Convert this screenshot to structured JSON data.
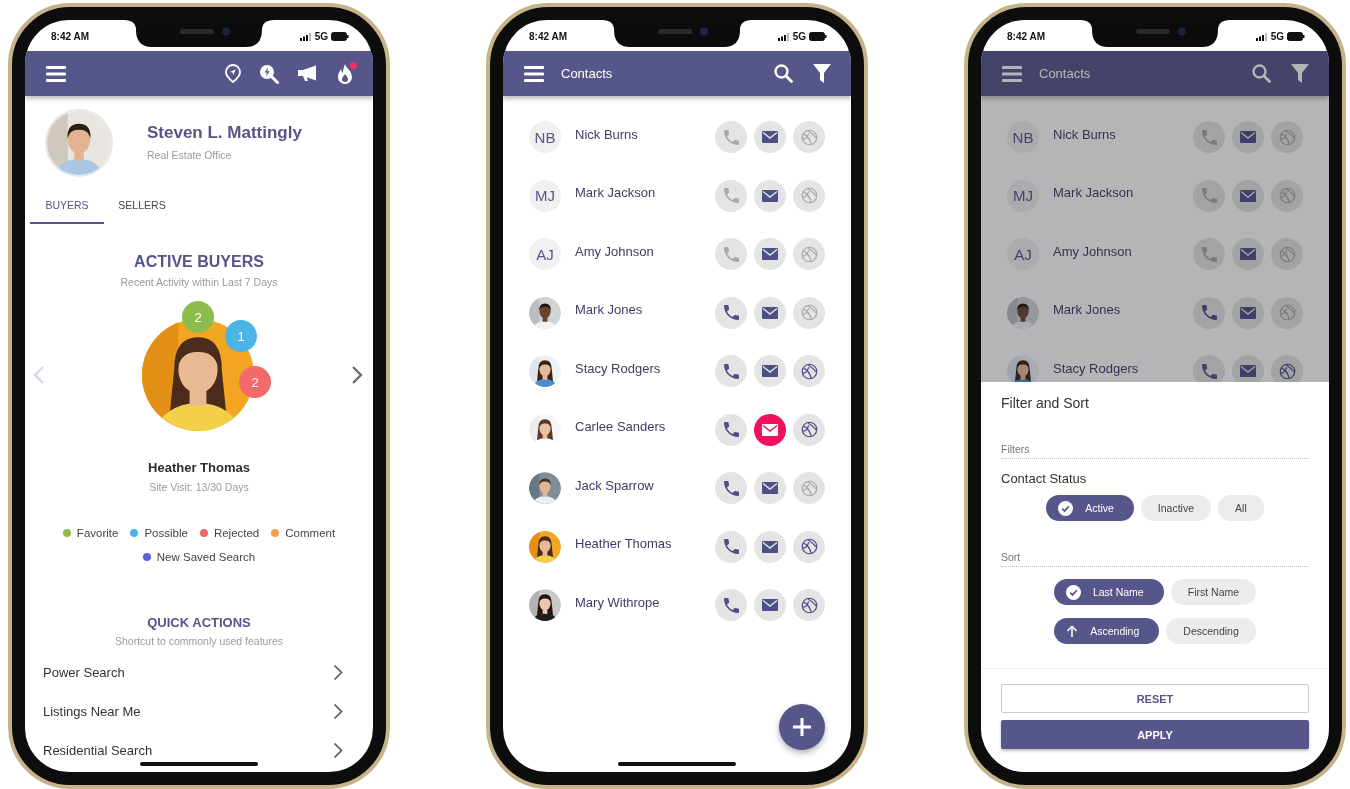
{
  "dashboard_screen": {
    "status_bar": {
      "time": "8:42 AM",
      "network": "5G"
    },
    "app_bar": {
      "fire_alert": true
    },
    "profile": {
      "name": "Steven L. Mattingly",
      "subtitle": "Real Estate Office"
    },
    "tabs": [
      {
        "label": "BUYERS",
        "selected": true
      },
      {
        "label": "SELLERS",
        "selected": false
      }
    ],
    "active_buyers": {
      "title": "ACTIVE BUYERS",
      "subtitle": "Recent Activity within Last 7 Days",
      "prev_disabled": true,
      "buyer_name": "Heather Thomas",
      "buyer_detail": "Site Visit: 13/30 Days",
      "badges": [
        {
          "count": "2",
          "color": "#8cbd4c"
        },
        {
          "count": "1",
          "color": "#4cb4e4"
        },
        {
          "count": "2",
          "color": "#f26a6a"
        }
      ]
    },
    "legend": [
      {
        "label": "Favorite",
        "color": "#8cbd4c"
      },
      {
        "label": "Possible",
        "color": "#4cb4e4"
      },
      {
        "label": "Rejected",
        "color": "#f26565"
      },
      {
        "label": "Comment",
        "color": "#f5a04a"
      },
      {
        "label": "New Saved Search",
        "color": "#5a64d6"
      }
    ],
    "quick_actions": {
      "title": "QUICK ACTIONS",
      "subtitle": "Shortcut to commonly used features",
      "items": [
        {
          "label": "Power Search"
        },
        {
          "label": "Listings Near Me"
        },
        {
          "label": "Residential Search"
        }
      ]
    }
  },
  "contacts_screen": {
    "status_bar": {
      "time": "8:42 AM",
      "network": "5G"
    },
    "title": "Contacts",
    "contacts": [
      {
        "kind": "initials",
        "initials": "NB",
        "name": "Nick Burns",
        "phone": false,
        "email_highlighted": false,
        "web": false
      },
      {
        "kind": "initials",
        "initials": "MJ",
        "name": "Mark Jackson",
        "phone": false,
        "email_highlighted": false,
        "web": false
      },
      {
        "kind": "initials",
        "initials": "AJ",
        "name": "Amy Johnson",
        "phone": false,
        "email_highlighted": false,
        "web": false
      },
      {
        "kind": "picture",
        "name": "Mark Jones",
        "phone": true,
        "email_highlighted": false,
        "web": false
      },
      {
        "kind": "picture",
        "name": "Stacy Rodgers",
        "phone": true,
        "email_highlighted": false,
        "web": true
      },
      {
        "kind": "picture",
        "name": "Carlee Sanders",
        "phone": true,
        "email_highlighted": true,
        "web": true
      },
      {
        "kind": "picture",
        "name": "Jack Sparrow",
        "phone": true,
        "email_highlighted": false,
        "web": false
      },
      {
        "kind": "picture",
        "name": "Heather Thomas",
        "phone": true,
        "email_highlighted": false,
        "web": true
      },
      {
        "kind": "picture",
        "name": "Mary Withrope",
        "phone": true,
        "email_highlighted": false,
        "web": true
      }
    ]
  },
  "filter_screen": {
    "status_bar": {
      "time": "8:42 AM",
      "network": "5G"
    },
    "title": "Contacts",
    "contacts": [
      {
        "kind": "initials",
        "initials": "NB",
        "name": "Nick Burns",
        "phone": false,
        "email_highlighted": false,
        "web": false
      },
      {
        "kind": "initials",
        "initials": "MJ",
        "name": "Mark Jackson",
        "phone": false,
        "email_highlighted": false,
        "web": false
      },
      {
        "kind": "initials",
        "initials": "AJ",
        "name": "Amy Johnson",
        "phone": false,
        "email_highlighted": false,
        "web": false
      },
      {
        "kind": "picture",
        "name": "Mark Jones",
        "phone": true,
        "email_highlighted": false,
        "web": false
      },
      {
        "kind": "picture",
        "name": "Stacy Rodgers",
        "phone": true,
        "email_highlighted": false,
        "web": true
      }
    ],
    "sheet": {
      "title": "Filter and Sort",
      "filters_label": "Filters",
      "status_label": "Contact Status",
      "status_options": [
        {
          "label": "Active",
          "selected": true
        },
        {
          "label": "Inactive",
          "selected": false
        },
        {
          "label": "All",
          "selected": false
        }
      ],
      "sort_label": "Sort",
      "sort_field_options": [
        {
          "label": "Last Name",
          "selected": true
        },
        {
          "label": "First Name",
          "selected": false
        }
      ],
      "sort_order_options": [
        {
          "label": "Ascending",
          "selected": true
        },
        {
          "label": "Descending",
          "selected": false
        }
      ],
      "reset_label": "RESET",
      "apply_label": "APPLY"
    }
  }
}
